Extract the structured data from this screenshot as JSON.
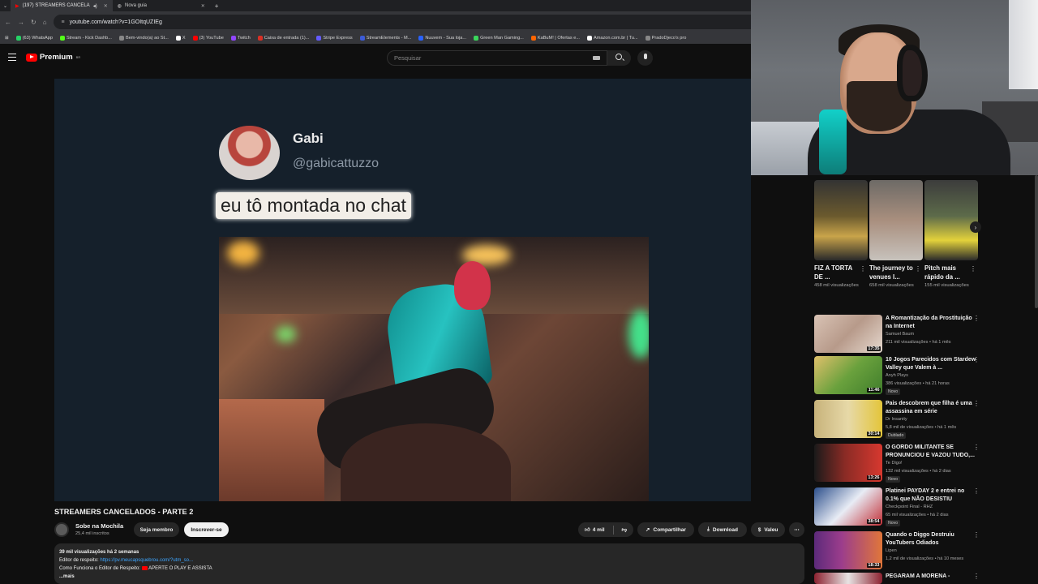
{
  "browser": {
    "tabs": [
      {
        "label": "(197) STREAMERS CANCELA",
        "active": true
      },
      {
        "label": "Nova guia",
        "active": false
      }
    ],
    "url": "youtube.com/watch?v=1GOItqUZIEg",
    "bookmarks": [
      "(63) WhatsApp",
      "Stream - Kick Dashb...",
      "Bem-vindo(a) ao St...",
      "X",
      "(3) YouTube",
      "Twitch",
      "Caixa de entrada (1)...",
      "Stripe Express",
      "StreamElements - M...",
      "Nuuvem - Sua loja...",
      "Green Man Gaming...",
      "KaBuM! | Ofertas e...",
      "Amazon.com.br | Tu...",
      "PradoDjeco's pro"
    ]
  },
  "header": {
    "logo_text": "Premium",
    "logo_region": "BR",
    "search_placeholder": "Pesquisar"
  },
  "player": {
    "tweet_name": "Gabi",
    "tweet_handle": "@gabicattuzzo",
    "tweet_text": "eu tô montada no chat"
  },
  "video": {
    "title": "STREAMERS CANCELADOS - PARTE 2",
    "channel_name": "Sobe na Mochila",
    "channel_subs": "25,4 mil inscritos",
    "join_label": "Seja membro",
    "subscribe_label": "Inscrever-se",
    "likes": "4 mil",
    "share_label": "Compartilhar",
    "download_label": "Download",
    "thanks_label": "Valeu",
    "views_line": "39 mil visualizações  há 2 semanas",
    "desc_line1_prefix": "Editor de respeito: ",
    "desc_line1_link": "https://pv.meucapsquebrou.com/?utm_so...",
    "desc_line2_prefix": "Como Funciona o Editor de Respeito: ",
    "desc_line2_suffix": " APERTE O PLAY E ASSISTA",
    "more_label": "...mais"
  },
  "shorts": [
    {
      "title": "FIZ A TORTA DE ...",
      "views": "458 mil visualizações",
      "color": "#6b5a2e"
    },
    {
      "title": "The journey to venues I...",
      "views": "658 mil visualizações",
      "color": "#a98f7e"
    },
    {
      "title": "Pitch mais rápido da ...",
      "views": "155 mil visualizações",
      "color": "#5d6b4a"
    }
  ],
  "recommendations": [
    {
      "title": "A Romantização da Prostituição na Internet",
      "channel": "Samuel Baum",
      "meta": "211 mil visualizações • há 1 mês",
      "duration": "17:35",
      "badge": "",
      "color": "#b79a8a"
    },
    {
      "title": "10 Jogos Parecidos com Stardew Valley que Valem à ...",
      "channel": "Anyh Plays",
      "meta": "386 visualizações • há 21 horas",
      "duration": "11:46",
      "badge": "Novo",
      "color": "#6aa13d"
    },
    {
      "title": "Pais descobrem que filha é uma assassina em série",
      "channel": "Dr Insanity",
      "meta": "5,8 mil de visualizações • há 1 mês",
      "duration": "30:14",
      "badge": "Dublado",
      "color": "#c7b27a"
    },
    {
      "title": "O GORDO MILITANTE SE PRONUNCIOU E VAZOU TUDO,...",
      "channel": "Te Digo!",
      "meta": "132 mil visualizações • há 2 dias",
      "duration": "13:26",
      "badge": "Novo",
      "color": "#8a2b25"
    },
    {
      "title": "Platinei PAYDAY 2 e entrei no 0.1% que NÃO DESISTIU",
      "channel": "Checkpoint Final - RHZ",
      "meta": "65 mil visualizações • há 2 dias",
      "duration": "38:54",
      "badge": "Novo",
      "color": "#2c4f8c"
    },
    {
      "title": "Quando o Diggo Destruiu YouTubers Odiados",
      "channel": "Lipen",
      "meta": "1,2 mil de visualizações • há 10 meses",
      "duration": "18:33",
      "badge": "",
      "color": "#9b3d8c"
    },
    {
      "title": "PEGARAM A MORENA -",
      "channel": "",
      "meta": "",
      "duration": "",
      "badge": "",
      "color": "#8c2230"
    }
  ]
}
